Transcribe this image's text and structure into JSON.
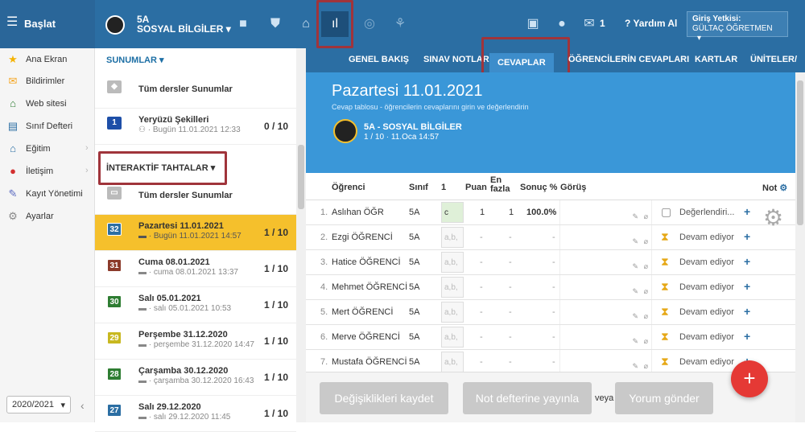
{
  "topbar": {
    "brand": "Başlat",
    "class_code": "5A",
    "class_name": "SOSYAL BİLGİLER",
    "msg_count": "1",
    "help": "Yardım Al",
    "auth_label": "Giriş Yetkisi:",
    "auth_user": "GÜLTAÇ ÖĞRETMEN"
  },
  "leftnav": {
    "items": [
      {
        "label": "Ana Ekran",
        "icon": "star-icon"
      },
      {
        "label": "Bildirimler",
        "icon": "mail-icon"
      },
      {
        "label": "Web sitesi",
        "icon": "home-icon"
      },
      {
        "label": "Sınıf Defteri",
        "icon": "notebook-icon"
      },
      {
        "label": "Eğitim",
        "icon": "education-icon"
      },
      {
        "label": "İletişim",
        "icon": "chat-icon"
      },
      {
        "label": "Kayıt Yönetimi",
        "icon": "pen-icon"
      },
      {
        "label": "Ayarlar",
        "icon": "gear-icon"
      }
    ],
    "year": "2020/2021"
  },
  "midlist": {
    "sunumlar_head": "SUNUMLAR",
    "sunum_all": "Tüm dersler Sunumlar",
    "sunum_item": {
      "title": "Yeryüzü Şekilleri",
      "sub": "Bugün 11.01.2021 12:33",
      "count": "0 / 10",
      "badge": "1"
    },
    "interaktif_head": "İNTERAKTİF TAHTALAR",
    "interaktif_all": "Tüm dersler Sunumlar",
    "items": [
      {
        "badge": "32",
        "title": "Pazartesi 11.01.2021",
        "sub": "Bugün 11.01.2021 14:57",
        "count": "1 / 10",
        "color": "#2b6ea3"
      },
      {
        "badge": "31",
        "title": "Cuma 08.01.2021",
        "sub": "cuma 08.01.2021 13:37",
        "count": "1 / 10",
        "color": "#8b3a2a"
      },
      {
        "badge": "30",
        "title": "Salı 05.01.2021",
        "sub": "salı 05.01.2021 10:53",
        "count": "1 / 10",
        "color": "#2e7d32"
      },
      {
        "badge": "29",
        "title": "Perşembe 31.12.2020",
        "sub": "perşembe 31.12.2020 14:47",
        "count": "1 / 10",
        "color": "#c8b820"
      },
      {
        "badge": "28",
        "title": "Çarşamba 30.12.2020",
        "sub": "çarşamba 30.12.2020 16:43",
        "count": "1 / 10",
        "color": "#2e7d32"
      },
      {
        "badge": "27",
        "title": "Salı 29.12.2020",
        "sub": "salı 29.12.2020 11:45",
        "count": "1 / 10",
        "color": "#2b6ea3"
      }
    ]
  },
  "tabs": [
    "GENEL BAKIŞ",
    "SINAV NOTLARI",
    "CEVAPLAR",
    "ÖĞRENCİLERİN CEVAPLARI",
    "KARTLAR",
    "ÜNİTELER/"
  ],
  "banner": {
    "title": "Pazartesi 11.01.2021",
    "subtitle": "Cevap tablosu - öğrencilerin cevaplarını girin ve değerlendirin",
    "class_line": "5A - SOSYAL BİLGİLER",
    "meta_line": "1 / 10 · 11.Oca 14:57"
  },
  "table": {
    "headers": {
      "ogrenci": "Öğrenci",
      "sinif": "Sınıf",
      "q1": "1",
      "puan": "Puan",
      "en": "En",
      "fazla": "fazla",
      "sonuc": "Sonuç %",
      "gorus": "Görüş",
      "not": "Not"
    },
    "rows": [
      {
        "num": "1.",
        "name": "Aslıhan ÖĞR",
        "sinif": "5A",
        "ans": "c",
        "puan": "1",
        "en": "1",
        "sonuc": "100.0%",
        "status": "Değerlendiri..."
      },
      {
        "num": "2.",
        "name": "Ezgi ÖĞRENCİ",
        "sinif": "5A",
        "ans": "a,b,",
        "puan": "-",
        "en": "-",
        "sonuc": "-",
        "status": "Devam ediyor"
      },
      {
        "num": "3.",
        "name": "Hatice ÖĞRENCİ",
        "sinif": "5A",
        "ans": "a,b,",
        "puan": "-",
        "en": "-",
        "sonuc": "-",
        "status": "Devam ediyor"
      },
      {
        "num": "4.",
        "name": "Mehmet ÖĞRENCİ",
        "sinif": "5A",
        "ans": "a,b,",
        "puan": "-",
        "en": "-",
        "sonuc": "-",
        "status": "Devam ediyor"
      },
      {
        "num": "5.",
        "name": "Mert ÖĞRENCİ",
        "sinif": "5A",
        "ans": "a,b,",
        "puan": "-",
        "en": "-",
        "sonuc": "-",
        "status": "Devam ediyor"
      },
      {
        "num": "6.",
        "name": "Merve ÖĞRENCİ",
        "sinif": "5A",
        "ans": "a,b,",
        "puan": "-",
        "en": "-",
        "sonuc": "-",
        "status": "Devam ediyor"
      },
      {
        "num": "7.",
        "name": "Mustafa ÖĞRENCİ",
        "sinif": "5A",
        "ans": "a,b,",
        "puan": "-",
        "en": "-",
        "sonuc": "-",
        "status": "Devam ediyor"
      }
    ]
  },
  "footer": {
    "save": "Değişiklikleri kaydet",
    "publish": "Not defterine yayınla",
    "or": "veya",
    "comment": "Yorum gönder"
  },
  "fab": "+"
}
